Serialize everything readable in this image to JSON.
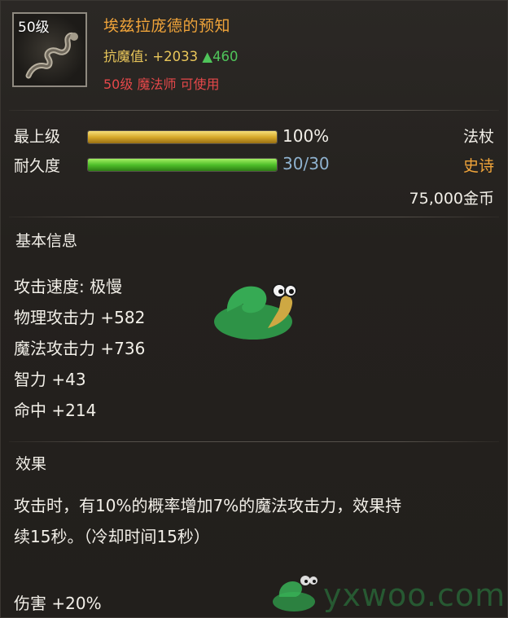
{
  "item": {
    "level_badge": "50级",
    "name": "埃兹拉庞德的预知",
    "resist_label": "抗魔值: +2033",
    "resist_up": "▲460",
    "requirement": "50级  魔法师 可使用",
    "icon": "staff-icon"
  },
  "bars": {
    "upgrade_label": "最上级",
    "upgrade_value": "100%",
    "upgrade_fraction": 1.0,
    "durability_label": "耐久度",
    "durability_value": "30/30",
    "durability_fraction": 1.0
  },
  "meta": {
    "type": "法杖",
    "rarity": "史诗",
    "price": "75,000金币"
  },
  "basic": {
    "title": "基本信息",
    "stats": [
      "攻击速度: 极慢",
      "物理攻击力 +582",
      "魔法攻击力 +736",
      "智力 +43",
      "命中 +214"
    ]
  },
  "effect": {
    "title": "效果",
    "line1": "攻击时，有10%的概率增加7%的魔法攻击力，效果持",
    "line2": "续15秒。（冷却时间15秒）",
    "damage": "伤害 +20%"
  },
  "colors": {
    "name": "#f0a43a",
    "resist": "#e9c65a",
    "resist_up": "#4fc45a",
    "requirement": "#e5484a",
    "rarity": "#f0a43a"
  },
  "watermark": {
    "text": "yxwoo.com"
  }
}
